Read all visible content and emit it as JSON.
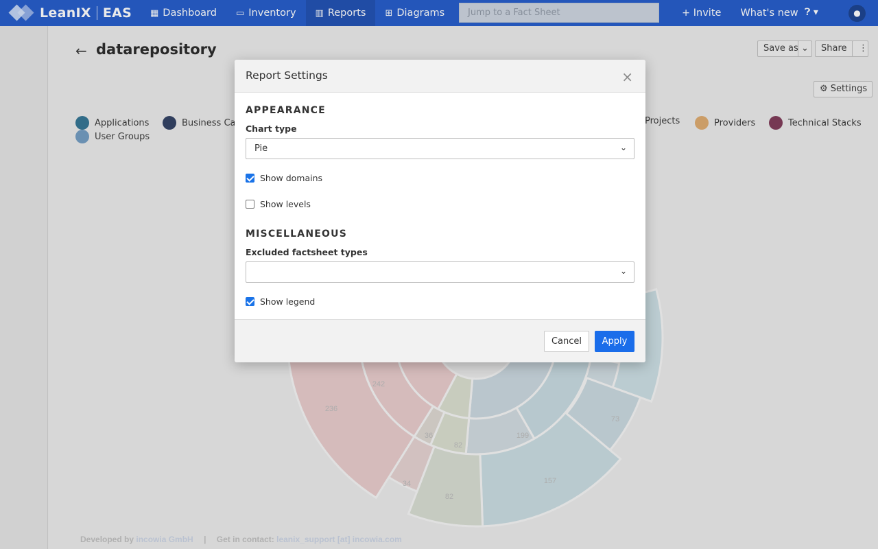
{
  "nav": {
    "brand_name": "LeanIX",
    "brand_product": "EAS",
    "links": [
      {
        "label": "Dashboard",
        "icon": "grid-icon"
      },
      {
        "label": "Inventory",
        "icon": "inventory-icon"
      },
      {
        "label": "Reports",
        "icon": "bar-chart-icon"
      },
      {
        "label": "Diagrams",
        "icon": "sitemap-icon"
      }
    ],
    "search_placeholder": "Jump to a Fact Sheet",
    "invite_label": "+ Invite",
    "whats_new_label": "What's new",
    "help_icon": "question-icon",
    "avatar_icon": "user-icon",
    "accent_color": "#1c56c8"
  },
  "page": {
    "title": "datarepository",
    "save_as_label": "Save as",
    "share_label": "Share",
    "settings_label": "Settings"
  },
  "legend": [
    {
      "label": "Applications",
      "color": "#2b6f8f"
    },
    {
      "label": "Business Cap",
      "color": "#2a3a5e"
    },
    {
      "label": "Projects",
      "color": "#8d9a9f"
    },
    {
      "label": "Providers",
      "color": "#dca769"
    },
    {
      "label": "Technical Stacks",
      "color": "#7a3352"
    },
    {
      "label": "User Groups",
      "color": "#6d98bf"
    }
  ],
  "chart_data": {
    "type": "pie",
    "title": "",
    "visible_value_labels": [
      {
        "label": "236",
        "series": "outer",
        "color": "#e7c9c9"
      },
      {
        "label": "242",
        "series": "inner",
        "color": "#e7c9c9"
      },
      {
        "label": "36",
        "series": "outer",
        "color": "#dcd6cf"
      },
      {
        "label": "82",
        "series": "inner",
        "color": "#d8ddcd"
      },
      {
        "label": "34",
        "series": "outer",
        "color": "#e4d0cf"
      },
      {
        "label": "82",
        "series": "outer",
        "color": "#d6dcd0"
      },
      {
        "label": "199",
        "series": "inner",
        "color": "#c5d8df"
      },
      {
        "label": "157",
        "series": "outer",
        "color": "#c7dbe1"
      },
      {
        "label": "73",
        "series": "outer",
        "color": "#c7d7de"
      }
    ]
  },
  "footer": {
    "developed_by": "Developed by",
    "company": "incowia GmbH",
    "divider": "|",
    "contact_label": "Get in contact:",
    "contact_value": "leanix_support [at] incowia.com"
  },
  "modal": {
    "title": "Report Settings",
    "close_icon": "close-icon",
    "appearance_heading": "APPEARANCE",
    "chart_type_label": "Chart type",
    "chart_type_value": "Pie",
    "show_domains_label": "Show domains",
    "show_domains_checked": true,
    "show_levels_label": "Show levels",
    "show_levels_checked": false,
    "misc_heading": "MISCELLANEOUS",
    "excluded_label": "Excluded factsheet types",
    "excluded_value": "",
    "show_legend_label": "Show legend",
    "show_legend_checked": true,
    "cancel_label": "Cancel",
    "apply_label": "Apply",
    "apply_color": "#1a6dea"
  }
}
